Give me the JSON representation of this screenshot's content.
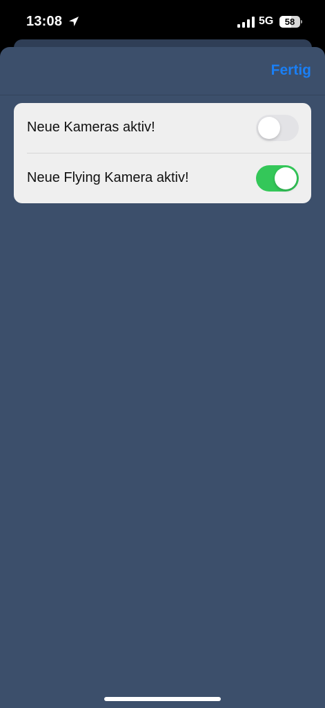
{
  "status_bar": {
    "time": "13:08",
    "location_icon": "location-arrow-icon",
    "signal_icon": "cellular-signal-icon",
    "network": "5G",
    "battery": {
      "level": 58,
      "label": "58"
    }
  },
  "nav": {
    "done_label": "Fertig"
  },
  "settings": [
    {
      "label": "Neue Kameras aktiv!",
      "enabled": false
    },
    {
      "label": "Neue Flying Kamera aktiv!",
      "enabled": true
    }
  ],
  "colors": {
    "sheet_background": "#3c4f6b",
    "accent": "#1a7ff5",
    "toggle_on": "#34c759",
    "toggle_off": "#e3e3e6"
  }
}
